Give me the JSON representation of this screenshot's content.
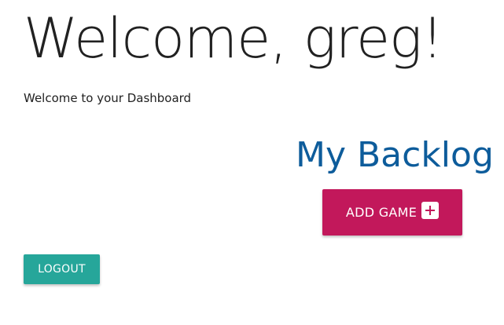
{
  "header": {
    "welcome_title": "Welcome, greg!",
    "welcome_subtitle": "Welcome to your Dashboard"
  },
  "backlog": {
    "title": "My Backlog",
    "add_button_label": "ADD GAME",
    "add_button_icon": "plus-square-icon"
  },
  "actions": {
    "logout_label": "LOGOUT"
  },
  "colors": {
    "backlog_title": "#0d5c9b",
    "add_button": "#c2185b",
    "logout_button": "#26a69a"
  }
}
